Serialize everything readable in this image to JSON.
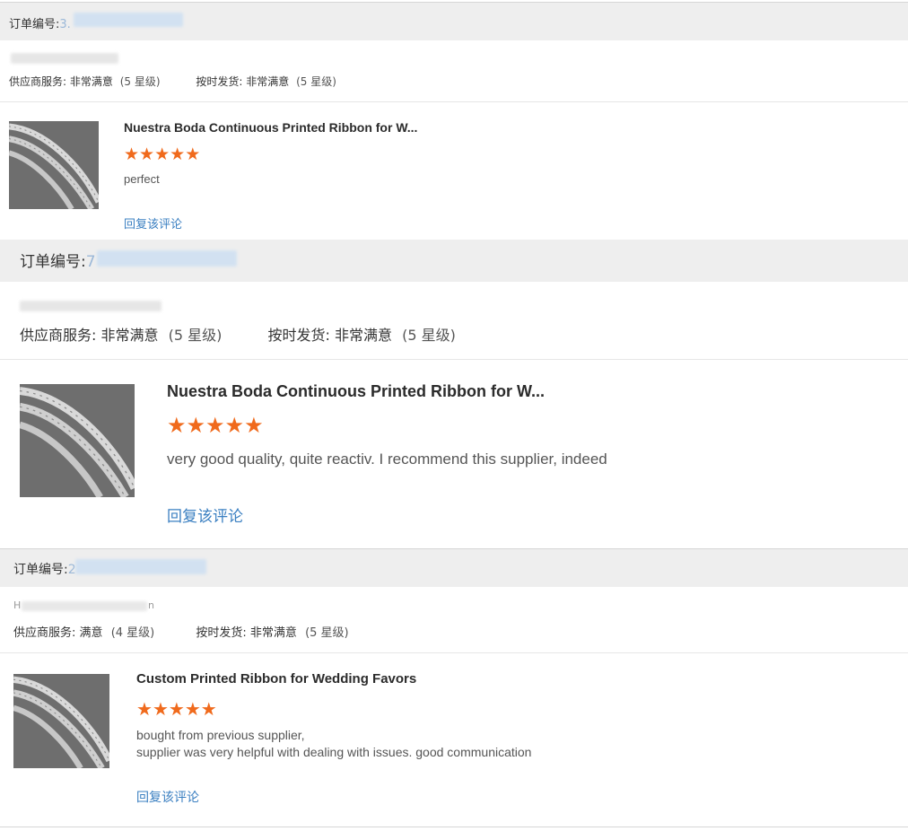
{
  "reviews": [
    {
      "order_label": "订单编号:",
      "order_number_visible": "3.",
      "buyer_name_visible": "",
      "supplier_service_label": "供应商服务:",
      "supplier_service_value": "非常满意",
      "supplier_service_level": "(5 星级)",
      "delivery_label": "按时发货:",
      "delivery_value": "非常满意",
      "delivery_level": "(5 星级)",
      "product_title": "Nuestra Boda Continuous Printed Ribbon for W...",
      "rating": 5,
      "stars": [
        "★",
        "★",
        "★",
        "★",
        "★"
      ],
      "comment_lines": [
        "perfect"
      ],
      "reply_label": "回复该评论"
    },
    {
      "order_label": "订单编号:",
      "order_number_visible": "7",
      "buyer_name_visible": "",
      "supplier_service_label": "供应商服务:",
      "supplier_service_value": "非常满意",
      "supplier_service_level": "(5 星级)",
      "delivery_label": "按时发货:",
      "delivery_value": "非常满意",
      "delivery_level": "(5 星级)",
      "product_title": "Nuestra Boda Continuous Printed Ribbon for W...",
      "rating": 5,
      "stars": [
        "★",
        "★",
        "★",
        "★",
        "★"
      ],
      "comment_lines": [
        "very good quality, quite reactiv. I recommend this supplier, indeed"
      ],
      "reply_label": "回复该评论"
    },
    {
      "order_label": "订单编号:",
      "order_number_visible": "2",
      "buyer_name_visible": "H",
      "buyer_name_tail_visible": "n",
      "supplier_service_label": "供应商服务:",
      "supplier_service_value": "满意",
      "supplier_service_level": "(4 星级)",
      "delivery_label": "按时发货:",
      "delivery_value": "非常满意",
      "delivery_level": "(5 星级)",
      "product_title": "Custom Printed Ribbon for Wedding Favors",
      "rating": 5,
      "stars": [
        "★",
        "★",
        "★",
        "★",
        "★"
      ],
      "comment_lines": [
        "bought from previous supplier,",
        "supplier was very helpful with dealing with issues. good communication"
      ],
      "reply_label": "回复该评论"
    }
  ],
  "colors": {
    "star": "#f06a1c",
    "reply_link": "#3a7fc1",
    "order_bar": "#eeeeee",
    "redaction": "#c9dcef"
  },
  "icons": {
    "star": "star-icon",
    "product_thumbnail": "ribbon-photo-thumbnail"
  }
}
